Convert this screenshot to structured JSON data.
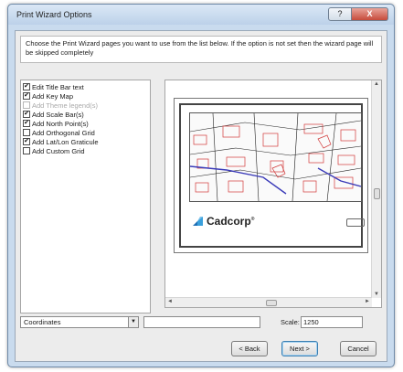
{
  "window": {
    "title": "Print Wizard Options",
    "help_label": "?",
    "close_label": "X"
  },
  "description": "Choose the Print Wizard pages you want to use from the list below.  If the option is not set then the wizard page will be skipped completely",
  "options": [
    {
      "label": "Edit Title Bar text",
      "checked": true,
      "enabled": true
    },
    {
      "label": "Add Key Map",
      "checked": true,
      "enabled": true
    },
    {
      "label": "Add Theme legend(s)",
      "checked": false,
      "enabled": false
    },
    {
      "label": "Add Scale Bar(s)",
      "checked": true,
      "enabled": true
    },
    {
      "label": "Add North Point(s)",
      "checked": true,
      "enabled": true
    },
    {
      "label": "Add Orthogonal Grid",
      "checked": false,
      "enabled": true
    },
    {
      "label": "Add Lat/Lon Graticule",
      "checked": true,
      "enabled": true
    },
    {
      "label": "Add Custom Grid",
      "checked": false,
      "enabled": true
    }
  ],
  "preview": {
    "logo_text": "Cadcorp",
    "logo_mark": "®"
  },
  "bottom": {
    "coordinate_mode": "Coordinates",
    "coordinate_value": "",
    "scale_label": "Scale:",
    "scale_value": "1250"
  },
  "buttons": {
    "back": "< Back",
    "next": "Next >",
    "cancel": "Cancel"
  },
  "colors": {
    "window_frame": "#c9dbee",
    "map_lines": "#d23a3a",
    "map_roads": "#3a3ab8"
  }
}
